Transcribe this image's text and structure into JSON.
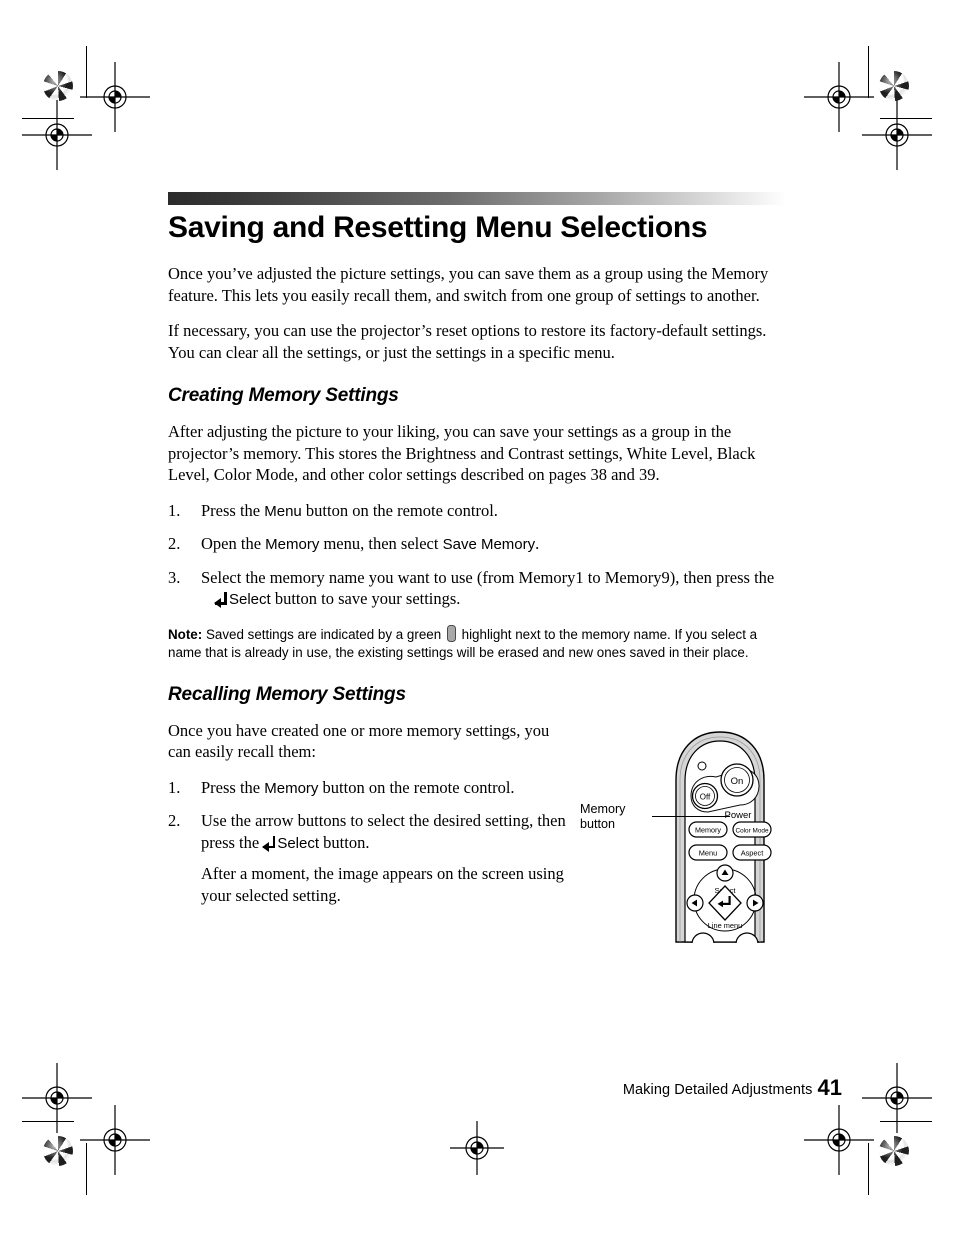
{
  "page": {
    "title": "Saving and Resetting Menu Selections",
    "intro_paragraphs": [
      "Once you’ve adjusted the picture settings, you can save them as a group using the Memory feature. This lets you easily recall them, and switch from one group of settings to another.",
      "If necessary, you can use the projector’s reset options to restore its factory-default settings. You can clear all the settings, or just the settings in a specific menu."
    ]
  },
  "creating": {
    "heading": "Creating Memory Settings",
    "intro": "After adjusting the picture to your liking, you can save your settings as a group in the projector’s memory. This stores the Brightness and Contrast settings, White Level, Black Level, Color Mode, and other color settings described on pages 38 and 39.",
    "steps": [
      {
        "num": "1.",
        "pre": "Press the ",
        "key": "Menu",
        "post": " button on the remote control.",
        "key2": "",
        "post2": "",
        "cont": ""
      },
      {
        "num": "2.",
        "pre": "Open the ",
        "key": "Memory",
        "post": " menu, then select ",
        "key2": "Save Memory",
        "post2": ".",
        "cont": ""
      },
      {
        "num": "3.",
        "pre": "Select the memory name you want to use (from Memory1 to Memory9), then press the ",
        "key": "",
        "post": "",
        "key2": "Select",
        "post2": " button to save your settings.",
        "cont": ""
      }
    ],
    "note": {
      "label": "Note:",
      "text_before_pill": " Saved settings are indicated by a green ",
      "text_after_pill": " highlight next to the memory name. If you select a name that is already in use, the existing settings will be erased and new ones saved in their place.",
      "pill_color": "#a9a9a9"
    }
  },
  "recalling": {
    "heading": "Recalling Memory Settings",
    "intro": "Once you have created one or more memory settings, you can easily recall them:",
    "steps": [
      {
        "num": "1.",
        "pre": "Press the ",
        "key": "Memory",
        "post": " button on the remote control.",
        "key2": "",
        "post2": "",
        "cont": ""
      },
      {
        "num": "2.",
        "pre": "Use the arrow buttons to select the desired setting, then press the ",
        "key": "",
        "post": "",
        "key2": "Select",
        "post2": " button.",
        "cont": "After a moment, the image appears on the screen using your selected setting."
      }
    ]
  },
  "remote": {
    "callout_line1": "Memory",
    "callout_line2": "button",
    "buttons": {
      "on": "On",
      "off": "Off",
      "power": "Power",
      "memory": "Memory",
      "color_mode": "Color Mode",
      "menu": "Menu",
      "aspect": "Aspect",
      "select": "Select",
      "line_menu": "Line menu"
    },
    "body_fill": "#d6d6d6",
    "face_fill": "#ffffff"
  },
  "footer": {
    "text": "Making Detailed Adjustments",
    "page_number": "41"
  }
}
